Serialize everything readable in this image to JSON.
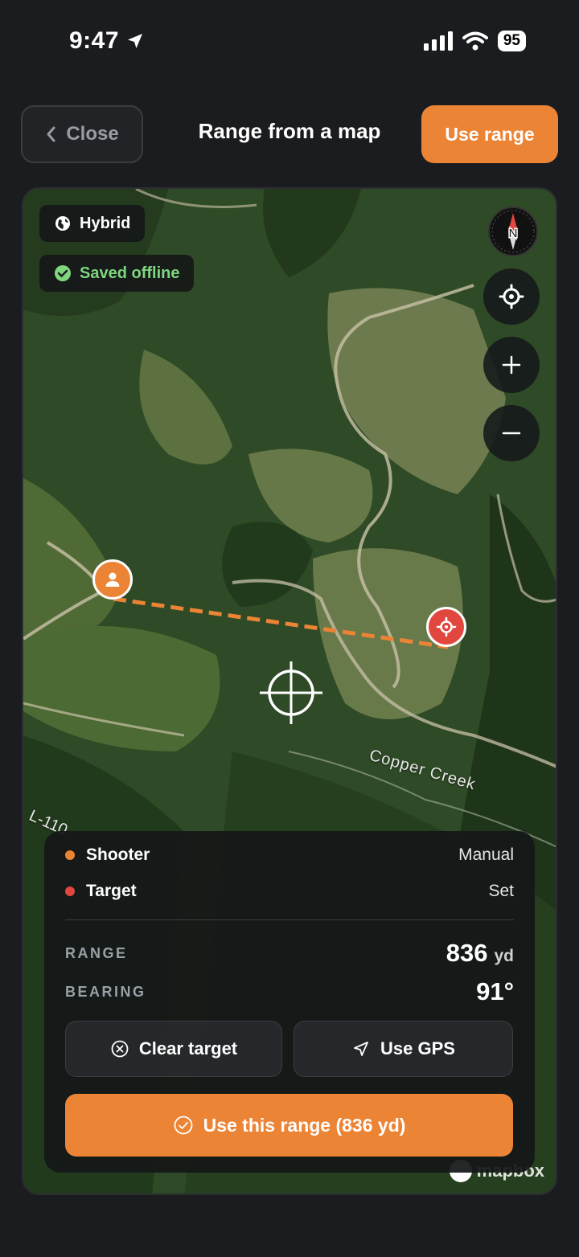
{
  "status_bar": {
    "time": "9:47",
    "battery": "95"
  },
  "header": {
    "close_label": "Close",
    "title": "Range from a map",
    "use_range_label": "Use range"
  },
  "map": {
    "layer_label": "Hybrid",
    "offline_label": "Saved offline",
    "compass_letter": "N",
    "place_label": "Copper Creek",
    "road_label": "L-110",
    "attribution": "mapbox"
  },
  "panel": {
    "shooter_label": "Shooter",
    "shooter_value": "Manual",
    "target_label": "Target",
    "target_value": "Set",
    "range_label": "RANGE",
    "range_value": "836",
    "range_unit": "yd",
    "bearing_label": "BEARING",
    "bearing_value": "91°",
    "clear_target_label": "Clear target",
    "use_gps_label": "Use GPS",
    "use_this_range_label": "Use this range (836 yd)"
  },
  "colors": {
    "accent": "#ec8436",
    "target": "#e2473f",
    "offline": "#7fd67f"
  }
}
